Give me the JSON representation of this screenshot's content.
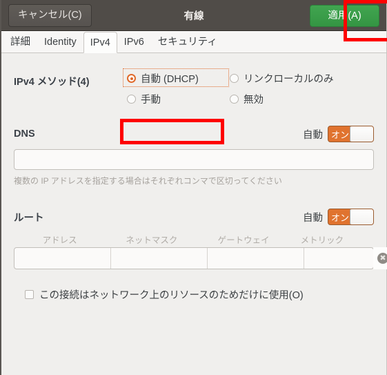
{
  "window": {
    "title": "有線",
    "background_color": "#f0efed"
  },
  "header": {
    "cancel_label": "キャンセル(C)",
    "title": "有線",
    "apply_label": "適用(A)",
    "apply_color": "#3b9b49",
    "bar_color": "#504c48"
  },
  "annotations": {
    "highlight_color": "#fe0000",
    "boxes": [
      "apply-button",
      "ipv4-method-auto-dhcp"
    ]
  },
  "tabs": [
    {
      "id": "details",
      "label": "詳細",
      "active": false
    },
    {
      "id": "identity",
      "label": "Identity",
      "active": false
    },
    {
      "id": "ipv4",
      "label": "IPv4",
      "active": true
    },
    {
      "id": "ipv6",
      "label": "IPv6",
      "active": false
    },
    {
      "id": "security",
      "label": "セキュリティ",
      "active": false
    }
  ],
  "ipv4": {
    "method": {
      "label": "IPv4 メソッド(4)",
      "selected": "auto_dhcp",
      "focused": "auto_dhcp",
      "options": [
        {
          "id": "auto_dhcp",
          "label": "自動 (DHCP)",
          "checked": true
        },
        {
          "id": "link_local",
          "label": "リンクローカルのみ",
          "checked": false
        },
        {
          "id": "manual",
          "label": "手動",
          "checked": false
        },
        {
          "id": "disabled",
          "label": "無効",
          "checked": false
        }
      ]
    },
    "dns": {
      "label": "DNS",
      "automatic_caption": "自動",
      "toggle_state": "オン",
      "toggle_on": true,
      "toggle_color": "#e0732f",
      "value": "",
      "placeholder": "",
      "hint": "複数の IP アドレスを指定する場合はそれぞれコンマで区切ってください"
    },
    "routes": {
      "label": "ルート",
      "automatic_caption": "自動",
      "toggle_state": "オン",
      "toggle_on": true,
      "toggle_color": "#e0732f",
      "columns": [
        "アドレス",
        "ネットマスク",
        "ゲートウェイ",
        "メトリック"
      ],
      "rows": [
        {
          "address": "",
          "netmask": "",
          "gateway": "",
          "metric": ""
        }
      ],
      "delete_icon": "close-circle-icon"
    },
    "restrict": {
      "label": "この接続はネットワーク上のリソースのためだけに使用(O)",
      "checked": false
    }
  }
}
